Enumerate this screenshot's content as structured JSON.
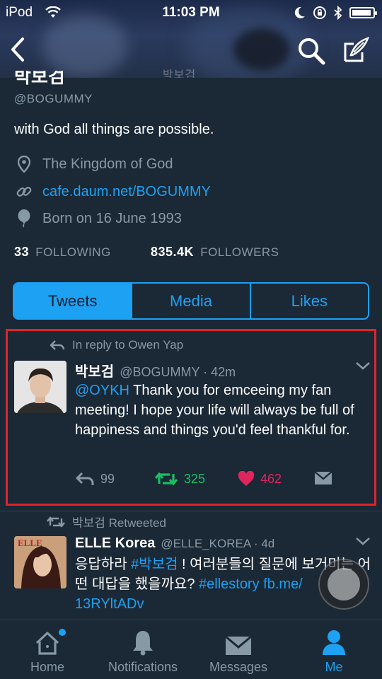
{
  "status_bar": {
    "carrier": "iPod",
    "time": "11:03 PM"
  },
  "header": {
    "ghost_text": "박보검"
  },
  "profile": {
    "name": "박보검",
    "handle": "@BOGUMMY",
    "bio": "with God all things are possible.",
    "location": "The Kingdom of God",
    "website": "cafe.daum.net/BOGUMMY",
    "birthday": "Born on 16 June 1993",
    "following_count": "33",
    "following_label": "FOLLOWING",
    "followers_count": "835.4K",
    "followers_label": "FOLLOWERS"
  },
  "tabs": [
    {
      "label": "Tweets",
      "active": true
    },
    {
      "label": "Media",
      "active": false
    },
    {
      "label": "Likes",
      "active": false
    }
  ],
  "tweet1": {
    "reply_to": "In reply to Owen Yap",
    "name": "박보검",
    "handle_time": "@BOGUMMY · 42m",
    "mention": "@OYKH",
    "text": " Thank you for emceeing my fan meeting! I hope your life will always be full of happiness and things you'd feel thankful for.",
    "replies": "99",
    "retweets": "325",
    "likes": "462"
  },
  "tweet2": {
    "retweeted_by": "박보검 Retweeted",
    "name": "ELLE Korea",
    "handle_time": "@ELLE_KOREA · 4d",
    "text_part1": "응답하라 ",
    "hashtag1": "#박보검",
    "text_part2": " ! 여러분들의 질문에 보거미는 어떤 대답을 했을까요? ",
    "hashtag2": "#ellestory",
    "link1": " fb.me/",
    "link2": "13RYltADv"
  },
  "tabbar": [
    {
      "label": "Home",
      "icon": "home-icon"
    },
    {
      "label": "Notifications",
      "icon": "bell-icon"
    },
    {
      "label": "Messages",
      "icon": "envelope-icon"
    },
    {
      "label": "Me",
      "icon": "person-icon"
    }
  ],
  "colors": {
    "background": "#1b2836",
    "accent": "#1da1f2",
    "muted": "#8899a6",
    "retweet_green": "#17bf63",
    "like_pink": "#e0245e",
    "highlight_red": "#e0232b"
  }
}
